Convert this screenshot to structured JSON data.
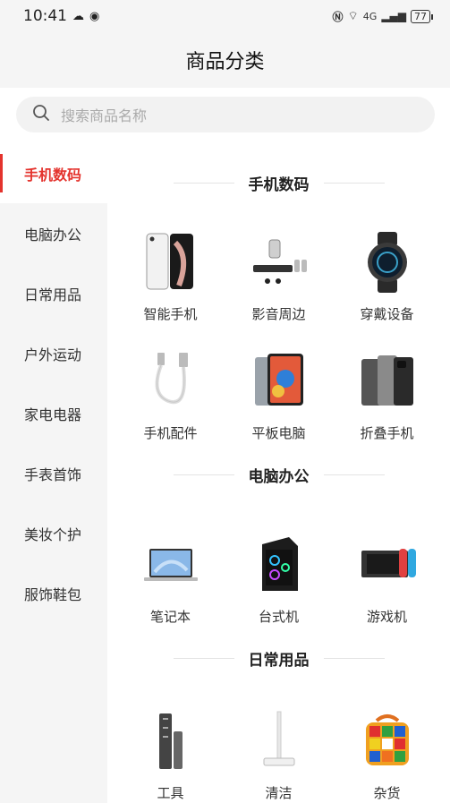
{
  "status": {
    "time": "10:41",
    "network": "4G",
    "battery": "77"
  },
  "header": {
    "title": "商品分类"
  },
  "search": {
    "placeholder": "搜索商品名称"
  },
  "sidebar": {
    "items": [
      {
        "label": "手机数码",
        "active": true
      },
      {
        "label": "电脑办公"
      },
      {
        "label": "日常用品"
      },
      {
        "label": "户外运动"
      },
      {
        "label": "家电电器"
      },
      {
        "label": "手表首饰"
      },
      {
        "label": "美妆个护"
      },
      {
        "label": "服饰鞋包"
      }
    ]
  },
  "sections": [
    {
      "title": "手机数码",
      "items": [
        {
          "label": "智能手机",
          "icon": "smartphone-icon"
        },
        {
          "label": "影音周边",
          "icon": "speaker-icon"
        },
        {
          "label": "穿戴设备",
          "icon": "smartwatch-icon"
        },
        {
          "label": "手机配件",
          "icon": "usb-cable-icon"
        },
        {
          "label": "平板电脑",
          "icon": "tablet-icon"
        },
        {
          "label": "折叠手机",
          "icon": "foldable-phone-icon"
        }
      ]
    },
    {
      "title": "电脑办公",
      "items": [
        {
          "label": "笔记本",
          "icon": "laptop-icon"
        },
        {
          "label": "台式机",
          "icon": "desktop-pc-icon"
        },
        {
          "label": "游戏机",
          "icon": "game-console-icon"
        }
      ]
    },
    {
      "title": "日常用品",
      "items": [
        {
          "label": "工具",
          "icon": "screwdriver-kit-icon"
        },
        {
          "label": "清洁",
          "icon": "mop-icon"
        },
        {
          "label": "杂货",
          "icon": "rubiks-cube-speaker-icon"
        }
      ]
    }
  ]
}
